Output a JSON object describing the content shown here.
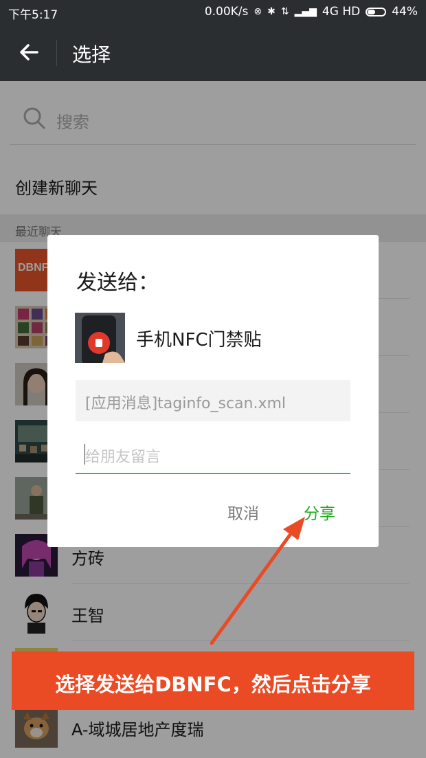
{
  "status_bar": {
    "time": "下午5:17",
    "net_speed": "0.00K/s",
    "network": "4G HD",
    "battery": "44%",
    "battery_level": 0.44
  },
  "app_bar": {
    "title": "选择",
    "back_icon": "arrow-left-icon"
  },
  "search": {
    "placeholder": "搜索",
    "icon": "search-icon"
  },
  "new_chat_label": "创建新聊天",
  "section_label": "最近聊天",
  "contacts": [
    {
      "name": ""
    },
    {
      "name": ""
    },
    {
      "name": ""
    },
    {
      "name": ""
    },
    {
      "name": ""
    },
    {
      "name": "方砖"
    },
    {
      "name": "王智"
    },
    {
      "name": ""
    },
    {
      "name": "A-域城居地产度瑞"
    }
  ],
  "dialog": {
    "title": "发送给：",
    "target": "手机NFC门禁贴",
    "message": "[应用消息]taginfo_scan.xml",
    "input_placeholder": "给朋友留言",
    "cancel": "取消",
    "share": "分享"
  },
  "annotation": {
    "banner": "选择发送给DBNFC，然后点击分享",
    "color": "#ea4a24",
    "avatar_logo": "DBNFC"
  },
  "colors": {
    "accent_green": "#1aad19",
    "dark_bar": "#2b2e31"
  }
}
